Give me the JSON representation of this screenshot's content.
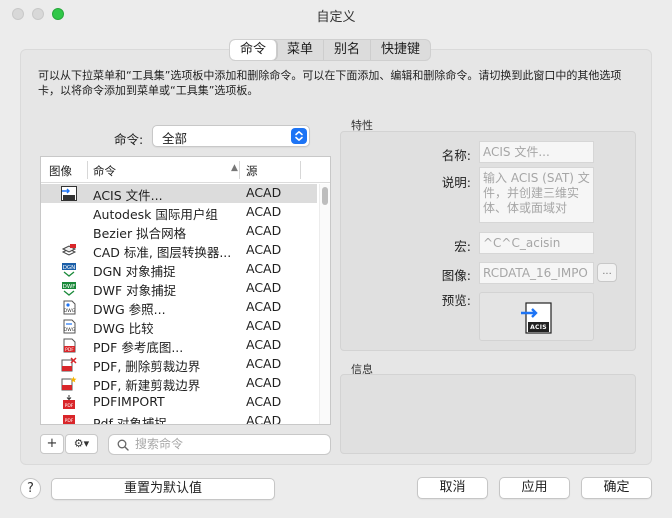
{
  "window": {
    "title": "自定义"
  },
  "tabs": [
    {
      "label": "命令",
      "active": true
    },
    {
      "label": "菜单",
      "active": false
    },
    {
      "label": "别名",
      "active": false
    },
    {
      "label": "快捷键",
      "active": false
    }
  ],
  "description": "可以从下拉菜单和“工具集”选项板中添加和删除命令。可以在下面添加、编辑和删除命令。请切换到此窗口中的其他选项卡，以将命令添加到菜单或“工具集”选项板。",
  "filter": {
    "label": "命令:",
    "value": "全部"
  },
  "table": {
    "headers": {
      "image": "图像",
      "command": "命令",
      "source": "源"
    },
    "rows": [
      {
        "icon": "acis-icon",
        "name": "ACIS 文件...",
        "source": "ACAD",
        "selected": true
      },
      {
        "icon": "",
        "name": "Autodesk 国际用户组",
        "source": "ACAD",
        "selected": false
      },
      {
        "icon": "",
        "name": "Bezier 拟合网格",
        "source": "ACAD",
        "selected": false
      },
      {
        "icon": "cad-standards-icon",
        "name": "CAD 标准, 图层转换器...",
        "source": "ACAD",
        "selected": false
      },
      {
        "icon": "dgn-icon",
        "name": "DGN 对象捕捉",
        "source": "ACAD",
        "selected": false
      },
      {
        "icon": "dwf-icon",
        "name": "DWF 对象捕捉",
        "source": "ACAD",
        "selected": false
      },
      {
        "icon": "dwg-reference-icon",
        "name": "DWG 参照...",
        "source": "ACAD",
        "selected": false
      },
      {
        "icon": "dwg-compare-icon",
        "name": "DWG 比较",
        "source": "ACAD",
        "selected": false
      },
      {
        "icon": "pdf-underlay-icon",
        "name": "PDF 参考底图...",
        "source": "ACAD",
        "selected": false
      },
      {
        "icon": "pdf-delete-clip-icon",
        "name": "PDF, 删除剪裁边界",
        "source": "ACAD",
        "selected": false
      },
      {
        "icon": "pdf-new-clip-icon",
        "name": "PDF, 新建剪裁边界",
        "source": "ACAD",
        "selected": false
      },
      {
        "icon": "pdf-import-icon",
        "name": "PDFIMPORT",
        "source": "ACAD",
        "selected": false
      },
      {
        "icon": "pdf-snap-icon",
        "name": "Pdf 对象捕捉...",
        "source": "ACAD",
        "selected": false
      }
    ]
  },
  "toolbar": {
    "add": "+",
    "gear_menu": "⚙▾"
  },
  "search": {
    "placeholder": "搜索命令"
  },
  "properties": {
    "title": "特性",
    "name_label": "名称:",
    "name_value": "ACIS 文件...",
    "desc_label": "说明:",
    "desc_value": "输入 ACIS (SAT) 文件，并创建三维实体、体或面域对",
    "macro_label": "宏:",
    "macro_value": "^C^C_acisin",
    "image_label": "图像:",
    "image_value": "RCDATA_16_IMPO",
    "image_browse": "...",
    "preview_label": "预览:",
    "preview_text": "ACIS"
  },
  "info": {
    "title": "信息"
  },
  "buttons": {
    "help": "?",
    "reset": "重置为默认值",
    "cancel": "取消",
    "apply": "应用",
    "ok": "确定"
  },
  "colors": {
    "accent": "#1d74f5",
    "traffic_green": "#30c748",
    "pdf_red": "#d9262a",
    "dgn_green": "#1a8a3a"
  }
}
